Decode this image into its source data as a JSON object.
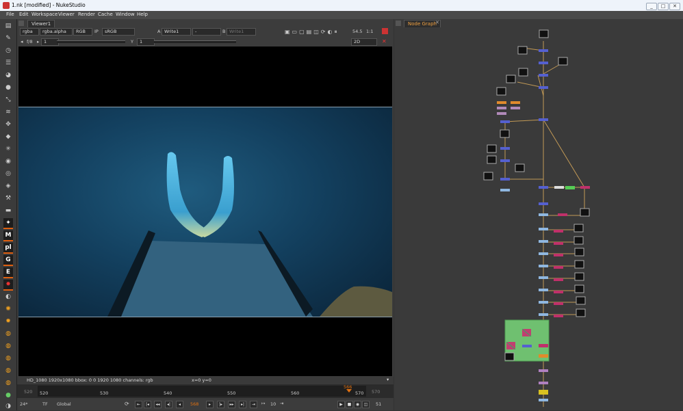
{
  "window": {
    "title": "1.nk [modified] - NukeStudio",
    "controls": [
      "_",
      "□",
      "✕"
    ]
  },
  "menu": [
    "File",
    "Edit",
    "Workspace",
    "Viewer",
    "Render",
    "Cache",
    "Window",
    "Help"
  ],
  "viewer": {
    "tab": "Viewer1",
    "row1": {
      "channels": "rgba",
      "alpha": "rgba.alpha",
      "colorspace": "RGB",
      "ip": "IP",
      "lut": "sRGB",
      "a_label": "A",
      "a_input": "Write1",
      "dash": "-",
      "b_label": "B",
      "b_input": "Write1",
      "zoom_value": "54.5",
      "zoom_ratio": "1:1"
    },
    "row2": {
      "fstop": "f/8",
      "frame_value": "1",
      "y_label": "Y",
      "y_value": "1",
      "mode": "2D"
    },
    "info": {
      "format": "HD_1080 1920x1080  bbox: 0 0 1920 1080 channels: rgb",
      "coords": "x=0 y=0"
    },
    "timeline": {
      "ticks": [
        "520",
        "530",
        "540",
        "550",
        "560",
        "570"
      ],
      "start": "520",
      "end": "570",
      "current": "568",
      "marker": "566"
    },
    "playback": {
      "fps": "24*",
      "tf": "TF",
      "scope": "Global",
      "frame": "568",
      "increment": "10",
      "end_frame": "51"
    }
  },
  "nodegraph": {
    "tab": "Node Graph"
  },
  "colors": {
    "accent": "#e07010",
    "backdrop": "#6fc070",
    "node": "#5560d0",
    "merge": "#c0306a"
  }
}
